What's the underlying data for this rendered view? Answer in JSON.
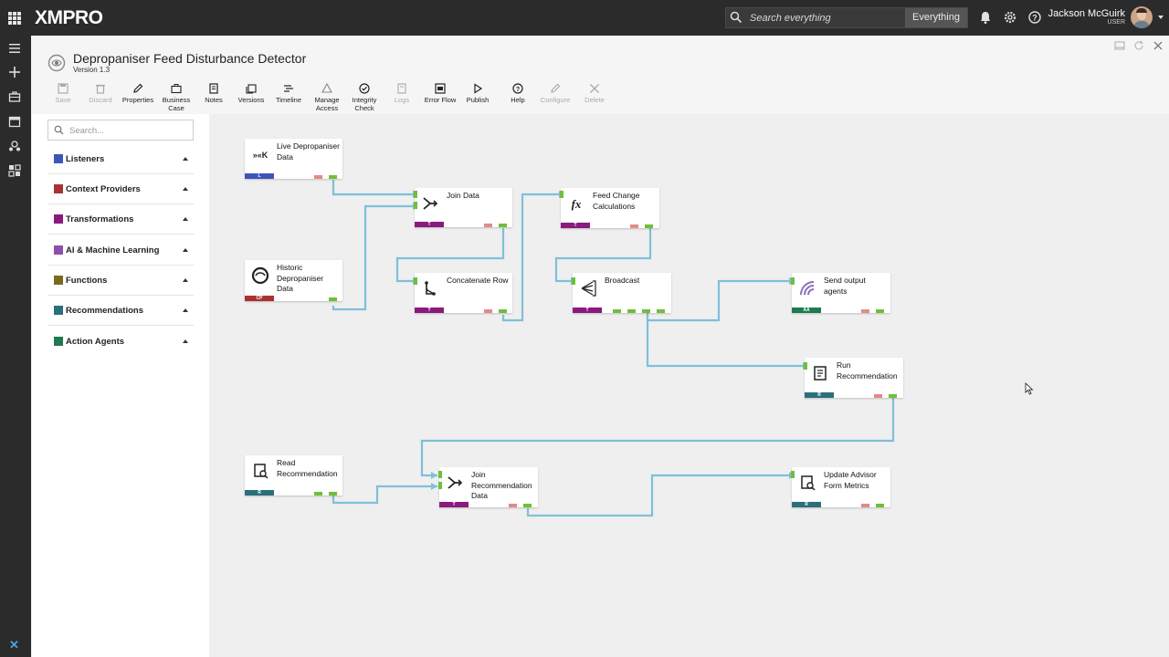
{
  "brand": {
    "logo": "XMPRO"
  },
  "topbar": {
    "search_placeholder": "Search everything",
    "search_scope": "Everything",
    "user_name": "Jackson McGuirk",
    "user_role": "USER"
  },
  "header": {
    "title": "Depropaniser Feed Disturbance Detector",
    "version": "Version 1.3"
  },
  "toolbar": [
    {
      "label": "Save",
      "icon": "save-icon",
      "enabled": false
    },
    {
      "label": "Discard",
      "icon": "trash-icon",
      "enabled": false
    },
    {
      "label": "Properties",
      "icon": "pencil-icon",
      "enabled": true
    },
    {
      "label": "Business Case",
      "icon": "briefcase-icon",
      "enabled": true
    },
    {
      "label": "Notes",
      "icon": "notes-icon",
      "enabled": true
    },
    {
      "label": "Versions",
      "icon": "versions-icon",
      "enabled": true
    },
    {
      "label": "Timeline",
      "icon": "timeline-icon",
      "enabled": true
    },
    {
      "label": "Manage Access",
      "icon": "access-icon",
      "enabled": true
    },
    {
      "label": "Integrity Check",
      "icon": "check-circle-icon",
      "enabled": true
    },
    {
      "label": "Logs",
      "icon": "logs-icon",
      "enabled": false
    },
    {
      "label": "Error Flow",
      "icon": "error-flow-icon",
      "enabled": true
    },
    {
      "label": "Publish",
      "icon": "play-icon",
      "enabled": true
    },
    {
      "label": "Help",
      "icon": "help-icon",
      "enabled": true
    },
    {
      "label": "Configure",
      "icon": "pencil-icon",
      "enabled": false
    },
    {
      "label": "Delete",
      "icon": "close-icon",
      "enabled": false
    }
  ],
  "sidebar": {
    "search_placeholder": "Search...",
    "categories": [
      {
        "label": "Listeners",
        "color": "#3b55b8"
      },
      {
        "label": "Context Providers",
        "color": "#a83232"
      },
      {
        "label": "Transformations",
        "color": "#8a1a7e"
      },
      {
        "label": "AI & Machine Learning",
        "color": "#8e4fa8"
      },
      {
        "label": "Functions",
        "color": "#7a6a1e"
      },
      {
        "label": "Recommendations",
        "color": "#2a6f7a"
      },
      {
        "label": "Action Agents",
        "color": "#1f7a4f"
      }
    ]
  },
  "nodes": [
    {
      "id": "live",
      "name": "Live Depropaniser Data",
      "tag": "L",
      "color": "#3b55b8",
      "icon": "kafka-icon"
    },
    {
      "id": "historic",
      "name": "Historic Depropaniser Data",
      "tag": "CP",
      "color": "#a83232",
      "icon": "historian-icon"
    },
    {
      "id": "join",
      "name": "Join Data",
      "tag": "T",
      "color": "#8a1a7e",
      "icon": "join-icon"
    },
    {
      "id": "concat",
      "name": "Concatenate Row",
      "tag": "T",
      "color": "#8a1a7e",
      "icon": "merge-icon"
    },
    {
      "id": "feedcalc",
      "name": "Feed Change Calculations",
      "tag": "T",
      "color": "#8a1a7e",
      "icon": "function-icon"
    },
    {
      "id": "broadcast",
      "name": "Broadcast",
      "tag": "T",
      "color": "#8a1a7e",
      "icon": "broadcast-icon"
    },
    {
      "id": "send",
      "name": "Send output agents",
      "tag": "AA",
      "color": "#1f7a4f",
      "icon": "output-agent-icon"
    },
    {
      "id": "runrec",
      "name": "Run Recommendation",
      "tag": "R",
      "color": "#2a6f7a",
      "icon": "recommendation-icon"
    },
    {
      "id": "readrec",
      "name": "Read Recommendation",
      "tag": "R",
      "color": "#2a6f7a",
      "icon": "read-recommendation-icon"
    },
    {
      "id": "joinrec",
      "name": "Join Recommendation Data",
      "tag": "T",
      "color": "#8a1a7e",
      "icon": "join-icon"
    },
    {
      "id": "update",
      "name": "Update Advisor Form Metrics",
      "tag": "R",
      "color": "#2a6f7a",
      "icon": "form-metrics-icon"
    }
  ],
  "colors": {
    "connector": "#7fbfd9",
    "pin_ok": "#6fbf3a",
    "pin_error": "#e38a8a",
    "topbar": "#2b2b2b"
  }
}
